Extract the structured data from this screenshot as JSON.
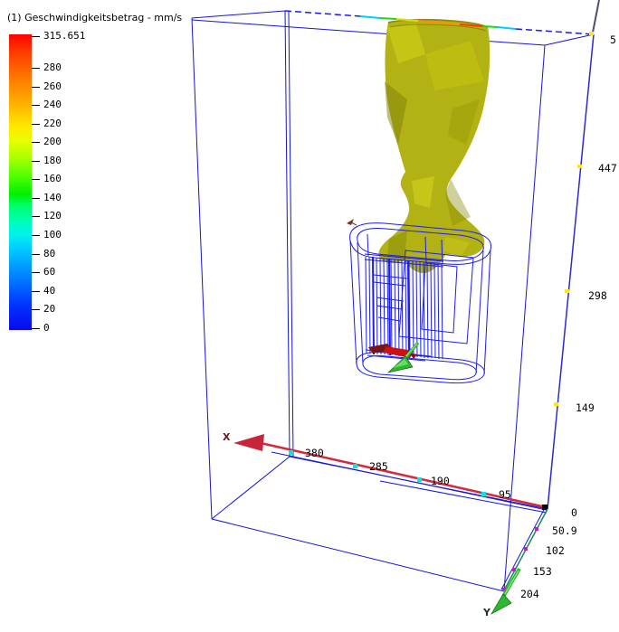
{
  "colorbar": {
    "title": "(1) Geschwindigkeitsbetrag - mm/s",
    "ticks": [
      "315.651",
      "280",
      "260",
      "240",
      "220",
      "200",
      "180",
      "160",
      "140",
      "120",
      "100",
      "80",
      "60",
      "40",
      "20",
      "0"
    ]
  },
  "rulers": {
    "height_axis": {
      "top_label": "5",
      "labels": [
        "447",
        "298",
        "149"
      ]
    },
    "x_axis": {
      "label": "X",
      "tick_labels": [
        "380",
        "285",
        "190",
        "95"
      ]
    },
    "y_axis": {
      "label": "Y",
      "origin_label": "0",
      "tick_labels": [
        "50.9",
        "102",
        "153",
        "204"
      ]
    }
  },
  "colors": {
    "box_wire": "#1515d6",
    "model_wire": "#1c1cf0",
    "isosurface": "#b2b214",
    "x_axis": "#d42a3c",
    "y_axis": "#2eb82e",
    "hot_element": "#cc1111",
    "height_tick": "#ffe81a",
    "x_tick": "#19dede",
    "y_tick": "#c21ec2"
  }
}
